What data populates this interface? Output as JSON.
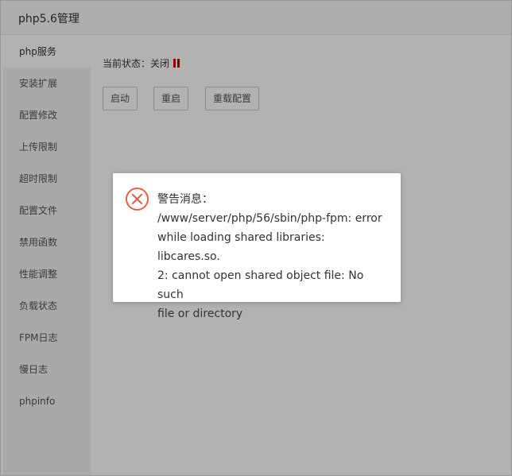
{
  "window": {
    "title": "php5.6管理"
  },
  "sidebar": {
    "items": [
      {
        "label": "php服务",
        "active": true
      },
      {
        "label": "安装扩展"
      },
      {
        "label": "配置修改"
      },
      {
        "label": "上传限制"
      },
      {
        "label": "超时限制"
      },
      {
        "label": "配置文件"
      },
      {
        "label": "禁用函数"
      },
      {
        "label": "性能调整"
      },
      {
        "label": "负载状态"
      },
      {
        "label": "FPM日志"
      },
      {
        "label": "慢日志"
      },
      {
        "label": "phpinfo"
      }
    ]
  },
  "main": {
    "status_label": "当前状态：关闭",
    "status_icon": "pause-icon",
    "status_color": "#c00000",
    "buttons": {
      "start": "启动",
      "restart": "重启",
      "reload": "重载配置"
    }
  },
  "dialog": {
    "icon": "error-circle-icon",
    "icon_color": "#e8604f",
    "title": "警告消息：",
    "lines": [
      "/www/server/php/56/sbin/php-fpm: error",
      "while loading shared libraries: libcares.so.",
      "2: cannot open shared object file: No such",
      "file or directory"
    ]
  }
}
